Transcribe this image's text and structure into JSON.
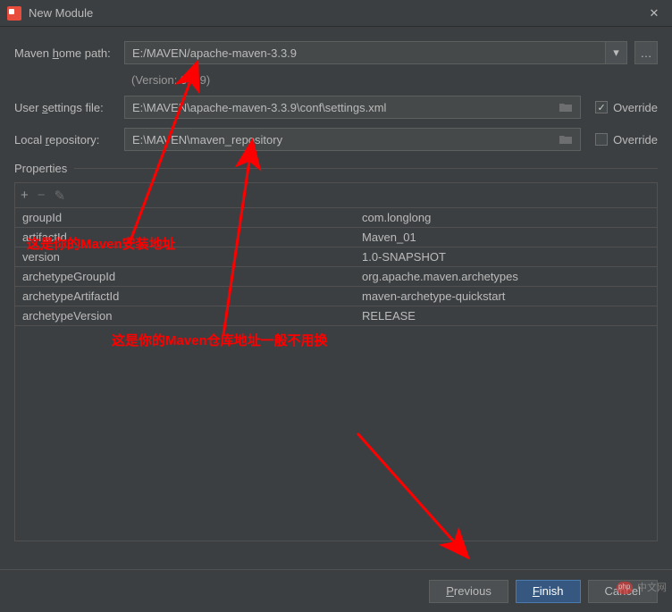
{
  "window": {
    "title": "New Module"
  },
  "labels": {
    "maven_home": "Maven home path:",
    "version": "(Version: 3.3.9)",
    "user_settings": "User settings file:",
    "local_repo": "Local repository:",
    "properties": "Properties",
    "override": "Override"
  },
  "fields": {
    "maven_home_value": "E:/MAVEN/apache-maven-3.3.9",
    "user_settings_value": "E:\\MAVEN\\apache-maven-3.3.9\\conf\\settings.xml",
    "local_repo_value": "E:\\MAVEN\\maven_repository",
    "user_settings_override": true,
    "local_repo_override": false
  },
  "properties_table": [
    {
      "key": "groupId",
      "value": "com.longlong"
    },
    {
      "key": "artifactId",
      "value": "Maven_01"
    },
    {
      "key": "version",
      "value": "1.0-SNAPSHOT"
    },
    {
      "key": "archetypeGroupId",
      "value": "org.apache.maven.archetypes"
    },
    {
      "key": "archetypeArtifactId",
      "value": "maven-archetype-quickstart"
    },
    {
      "key": "archetypeVersion",
      "value": "RELEASE"
    }
  ],
  "buttons": {
    "previous": "Previous",
    "finish": "Finish",
    "cancel": "Cancel"
  },
  "annotations": {
    "anno1": "这是你的Maven安装地址",
    "anno2": "这是你的Maven仓库地址一般不用换"
  },
  "watermark": "中文网"
}
